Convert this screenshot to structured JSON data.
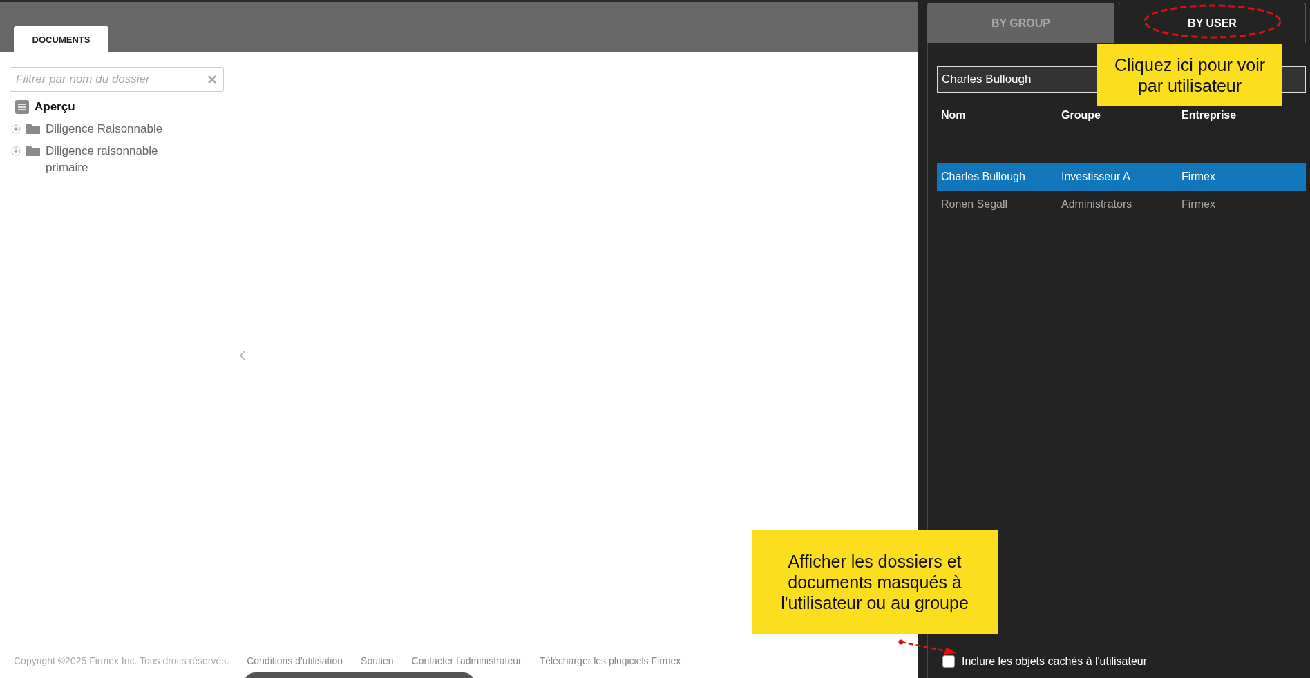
{
  "tabs": [
    {
      "label": "DOCUMENTS",
      "selected": true
    }
  ],
  "filter": {
    "placeholder": "Filtrer par nom du dossier"
  },
  "tree": [
    {
      "label": "Aperçu",
      "kind": "overview"
    },
    {
      "label": "Diligence Raisonnable",
      "kind": "folder",
      "expanded": false
    },
    {
      "label": "Diligence raisonnable primaire",
      "kind": "folder",
      "expanded": false
    }
  ],
  "footer": {
    "copyright": "Copyright ©2025 Firmex Inc. Tous droits réservés.",
    "links": [
      "Conditions d'utilisation",
      "Soutien",
      "Contacter l'administrateur",
      "Télécharger les plugiciels Firmex"
    ]
  },
  "view_tabs": [
    {
      "label": "BY GROUP",
      "selected": false
    },
    {
      "label": "BY USER",
      "selected": true
    }
  ],
  "user_field": {
    "value": "Charles Bullough"
  },
  "table": {
    "columns": [
      "Nom",
      "Groupe",
      "Entreprise"
    ],
    "rows": [
      {
        "cells": [
          "Charles Bullough",
          "Investisseur A",
          "Firmex"
        ],
        "selected": true
      },
      {
        "cells": [
          "Ronen Segall",
          "Administrators",
          "Firmex"
        ],
        "selected": false
      }
    ]
  },
  "include_hidden": {
    "label": "Inclure les objets cachés à l'utilisateur",
    "checked": false
  },
  "callouts": [
    {
      "kind": "upper",
      "text": "Cliquez ici pour voir par utilisateur"
    },
    {
      "kind": "lower",
      "text": "Afficher les dossiers et documents masqués à l'utilisateur ou au groupe"
    }
  ]
}
